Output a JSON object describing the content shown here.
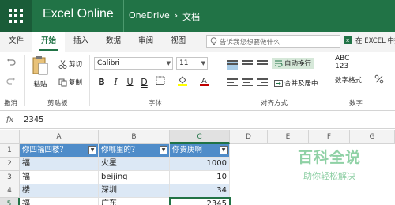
{
  "topbar": {
    "app_name": "Excel Online",
    "breadcrumb_root": "OneDrive",
    "breadcrumb_sep": "›",
    "breadcrumb_folder": "文档"
  },
  "tabs": [
    "文件",
    "开始",
    "插入",
    "数据",
    "审阅",
    "视图"
  ],
  "active_tab": "开始",
  "tellme": {
    "placeholder": "告诉我您想要做什么"
  },
  "open_in_excel": "在 EXCEL 中打",
  "clipboard": {
    "undo_icon": "undo-icon",
    "redo_icon": "redo-icon",
    "undo_label": "撤消",
    "paste_label": "粘贴",
    "cut_label": "剪切",
    "copy_label": "复制",
    "group_label": "剪贴板"
  },
  "font": {
    "family": "Calibri",
    "size": "11",
    "bold": "B",
    "italic": "I",
    "underline": "U",
    "strike": "D",
    "group_label": "字体",
    "highlight_color": "#ffff00",
    "font_color": "#c00000"
  },
  "alignment": {
    "wrap_label": "自动换行",
    "merge_label": "合并及居中",
    "group_label": "对齐方式"
  },
  "number": {
    "format_sample": "ABC 123",
    "format_label": "数字格式",
    "group_label": "数字"
  },
  "formula_bar": {
    "fx": "fx",
    "value": "2345"
  },
  "columns": [
    "A",
    "B",
    "C",
    "D",
    "E",
    "F",
    "G"
  ],
  "selected_column": "C",
  "rows": [
    "1",
    "2",
    "3",
    "4",
    "5"
  ],
  "selected_row": "5",
  "table": {
    "headers": [
      "你四福四楼？",
      "你哪里的？",
      "你贵庚啊"
    ],
    "data": [
      [
        "福",
        "火星",
        "1000"
      ],
      [
        "福",
        "beijing",
        "10"
      ],
      [
        "楼",
        "深圳",
        "34"
      ],
      [
        "福",
        "广东",
        "2345"
      ]
    ]
  },
  "watermark": {
    "title": "百科全说",
    "subtitle": "助你轻松解决"
  },
  "colors": {
    "brand": "#217346",
    "table_header": "#4f8cc9",
    "table_band": "#dce8f5"
  }
}
